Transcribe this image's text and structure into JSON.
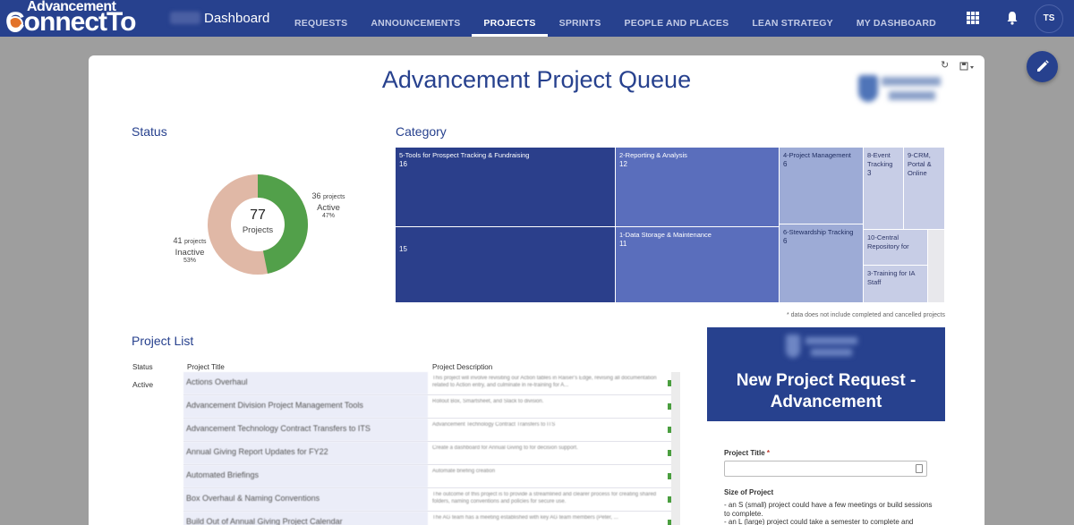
{
  "app": {
    "logo_line1": "Advancement",
    "logo_line2": "ConnectTo",
    "page_name": "Dashboard"
  },
  "nav": {
    "items": [
      {
        "label": "REQUESTS"
      },
      {
        "label": "ANNOUNCEMENTS"
      },
      {
        "label": "PROJECTS",
        "active": true
      },
      {
        "label": "SPRINTS"
      },
      {
        "label": "PEOPLE AND PLACES"
      },
      {
        "label": "LEAN STRATEGY"
      },
      {
        "label": "MY DASHBOARD"
      }
    ],
    "user_initials": "TS",
    "icons": [
      "apps-grid-icon",
      "bell-icon"
    ]
  },
  "dashboard": {
    "title": "Advancement Project Queue",
    "status_title": "Status",
    "category_title": "Category",
    "footnote": "* data does not include completed and cancelled projects",
    "colors": {
      "brand": "#27418e",
      "active": "#52a04a",
      "inactive": "#e0b8a6"
    }
  },
  "status_donut": {
    "total": "77",
    "total_label": "Projects",
    "active": {
      "count": "36",
      "unit": "projects",
      "label": "Active",
      "pct": "47%",
      "value": 36
    },
    "inactive": {
      "count": "41",
      "unit": "projects",
      "label": "Inactive",
      "pct": "53%",
      "value": 41
    }
  },
  "category_treemap": {
    "tiles": [
      {
        "label": "5-Tools for Prospect Tracking & Fundraising",
        "count": "16"
      },
      {
        "label": "",
        "count": "15"
      },
      {
        "label": "2-Reporting & Analysis",
        "count": "12"
      },
      {
        "label": "1-Data Storage & Maintenance",
        "count": "11"
      },
      {
        "label": "4-Project Management",
        "count": "6"
      },
      {
        "label": "6-Stewardship Tracking",
        "count": "6"
      },
      {
        "label": "8-Event Tracking",
        "count": "3"
      },
      {
        "label": "9-CRM, Portal & Online",
        "count": ""
      },
      {
        "label": "10-Central Repository for",
        "count": ""
      },
      {
        "label": "3-Training for IA Staff",
        "count": ""
      }
    ]
  },
  "project_list": {
    "title": "Project List",
    "headers": {
      "status": "Status",
      "title": "Project Title",
      "description": "Project Description"
    },
    "status_value": "Active",
    "rows": [
      {
        "title": "Actions Overhaul",
        "description": "This project will involve revisiting our Action tables in Raiser's Edge, revising all documentation related to Action entry, and culminate in re-training for A..."
      },
      {
        "title": "Advancement Division Project Management Tools",
        "description": "Rollout Box, Smartsheet, and Slack to division."
      },
      {
        "title": "Advancement Technology Contract Transfers to ITS",
        "description": "Advancement Technology Contract Transfers to ITS"
      },
      {
        "title": "Annual Giving Report Updates for FY22",
        "description": "Create a dashboard for Annual Giving to for decision support."
      },
      {
        "title": "Automated Briefings",
        "description": "Automate briefing creation"
      },
      {
        "title": "Box Overhaul & Naming Conventions",
        "description": "The outcome of this project is to provide a streamlined and clearer process for creating shared folders, naming conventions and policies for secure use."
      },
      {
        "title": "Build Out of Annual Giving Project Calendar",
        "description": "The AG team has a meeting established with key AG team members (Peter, ..."
      }
    ]
  },
  "request_form": {
    "banner_title": "New Project Request - Advancement",
    "project_title_label": "Project Title",
    "required_mark": "*",
    "size_label": "Size of Project",
    "size_lines": [
      "- an S (small) project could have a few meetings or build sessions to complete.",
      "- an L (large) project could take a semester to complete and"
    ]
  }
}
